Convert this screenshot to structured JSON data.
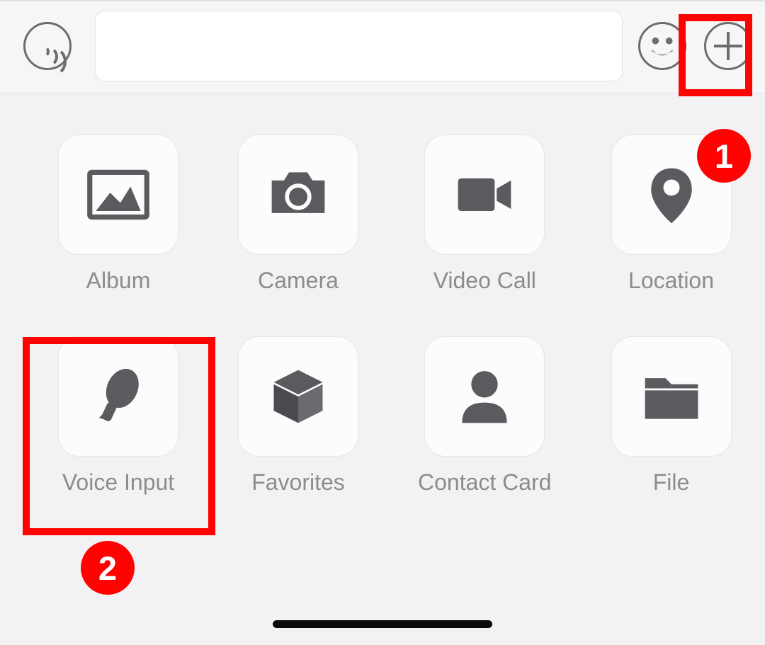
{
  "topbar": {
    "voice_btn": "voice-mode",
    "input_value": "",
    "emoji_btn": "emoji",
    "plus_btn": "more"
  },
  "annotations": {
    "badge1": "1",
    "badge2": "2"
  },
  "grid": [
    {
      "id": "album",
      "label": "Album",
      "icon": "photo-icon"
    },
    {
      "id": "camera",
      "label": "Camera",
      "icon": "camera-icon"
    },
    {
      "id": "videocall",
      "label": "Video Call",
      "icon": "video-icon"
    },
    {
      "id": "location",
      "label": "Location",
      "icon": "location-icon"
    },
    {
      "id": "voiceinput",
      "label": "Voice Input",
      "icon": "mic-icon"
    },
    {
      "id": "favorites",
      "label": "Favorites",
      "icon": "cube-icon"
    },
    {
      "id": "contactcard",
      "label": "Contact Card",
      "icon": "person-icon"
    },
    {
      "id": "file",
      "label": "File",
      "icon": "folder-icon"
    }
  ]
}
